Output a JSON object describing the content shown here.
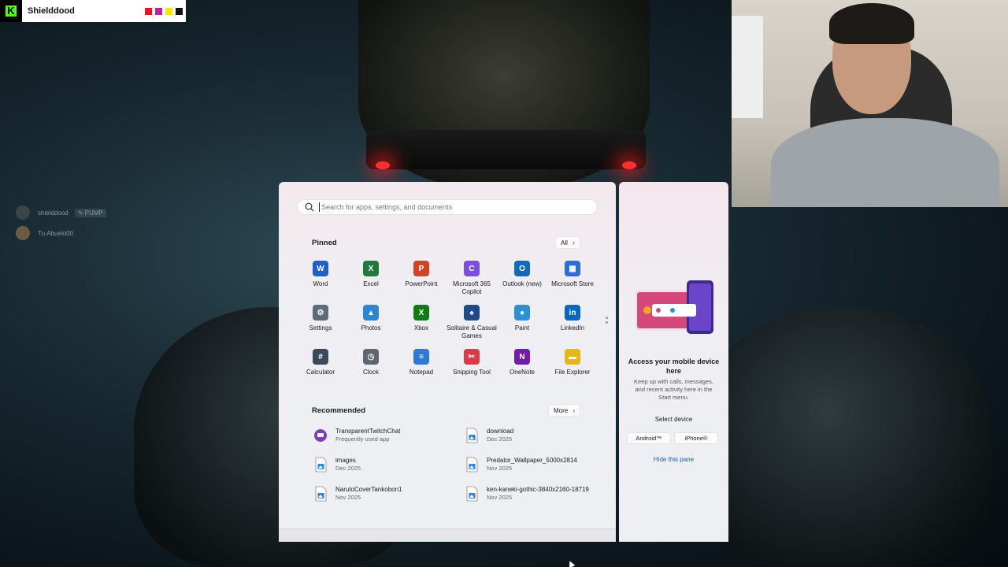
{
  "stream": {
    "channel_name": "Shielddood",
    "swatch_colors": [
      "#e8141e",
      "#b5289b",
      "#f5e312",
      "#111111"
    ]
  },
  "chat": [
    {
      "user": "shielddood",
      "badge": "PUMP"
    },
    {
      "user": "Tu.Abuelo00",
      "badge": ""
    }
  ],
  "search": {
    "placeholder": "Search for apps, settings, and documents"
  },
  "pinned": {
    "title": "Pinned",
    "all_label": "All",
    "apps": [
      {
        "label": "Word",
        "icon": "word-icon",
        "color": "#1f5fc8",
        "glyph": "W"
      },
      {
        "label": "Excel",
        "icon": "excel-icon",
        "color": "#1d7a3e",
        "glyph": "X"
      },
      {
        "label": "PowerPoint",
        "icon": "powerpoint-icon",
        "color": "#d04423",
        "glyph": "P"
      },
      {
        "label": "Microsoft 365 Copilot",
        "icon": "copilot-icon",
        "color": "#7b4ee0",
        "glyph": "C"
      },
      {
        "label": "Outlook (new)",
        "icon": "outlook-icon",
        "color": "#0f6cbd",
        "glyph": "O"
      },
      {
        "label": "Microsoft Store",
        "icon": "store-icon",
        "color": "#2b6fd6",
        "glyph": "▦"
      },
      {
        "label": "Settings",
        "icon": "gear-icon",
        "color": "#5b6b7a",
        "glyph": "⚙"
      },
      {
        "label": "Photos",
        "icon": "photos-icon",
        "color": "#2c86d4",
        "glyph": "▲"
      },
      {
        "label": "Xbox",
        "icon": "xbox-icon",
        "color": "#107c10",
        "glyph": "X"
      },
      {
        "label": "Solitaire & Casual Games",
        "icon": "solitaire-icon",
        "color": "#1e4a8a",
        "glyph": "♠"
      },
      {
        "label": "Paint",
        "icon": "paint-icon",
        "color": "#2d8fd5",
        "glyph": "●"
      },
      {
        "label": "LinkedIn",
        "icon": "linkedin-icon",
        "color": "#0a66c2",
        "glyph": "in"
      },
      {
        "label": "Calculator",
        "icon": "calculator-icon",
        "color": "#3a4a5c",
        "glyph": "#"
      },
      {
        "label": "Clock",
        "icon": "clock-icon",
        "color": "#5e6670",
        "glyph": "◷"
      },
      {
        "label": "Notepad",
        "icon": "notepad-icon",
        "color": "#2b7bd6",
        "glyph": "≡"
      },
      {
        "label": "Snipping Tool",
        "icon": "snipping-tool-icon",
        "color": "#d93a4a",
        "glyph": "✂"
      },
      {
        "label": "OneNote",
        "icon": "onenote-icon",
        "color": "#7719aa",
        "glyph": "N"
      },
      {
        "label": "File Explorer",
        "icon": "folder-icon",
        "color": "#e8b416",
        "glyph": "▬"
      }
    ]
  },
  "recommended": {
    "title": "Recommended",
    "more_label": "More",
    "items": [
      {
        "title": "TransparentTwitchChat",
        "subtitle": "Frequently used app",
        "icon": "twitch-chat-icon"
      },
      {
        "title": "download",
        "subtitle": "Dec 2025",
        "icon": "image-file-icon"
      },
      {
        "title": "images",
        "subtitle": "Dec 2025",
        "icon": "image-file-icon"
      },
      {
        "title": "Predator_Wallpaper_5000x2814",
        "subtitle": "Nov 2025",
        "icon": "image-file-icon"
      },
      {
        "title": "NarutoCoverTankobon1",
        "subtitle": "Nov 2025",
        "icon": "image-file-icon"
      },
      {
        "title": "ken-kaneki-gothic-3840x2160-18719",
        "subtitle": "Nov 2025",
        "icon": "image-file-icon"
      }
    ]
  },
  "phone_pane": {
    "title": "Access your mobile device here",
    "description": "Keep up with calls, messages, and recent activity here in the Start menu.",
    "select_device": "Select device",
    "android_label": "Android™",
    "iphone_label": "iPhone®",
    "hide_label": "Hide this pane"
  }
}
